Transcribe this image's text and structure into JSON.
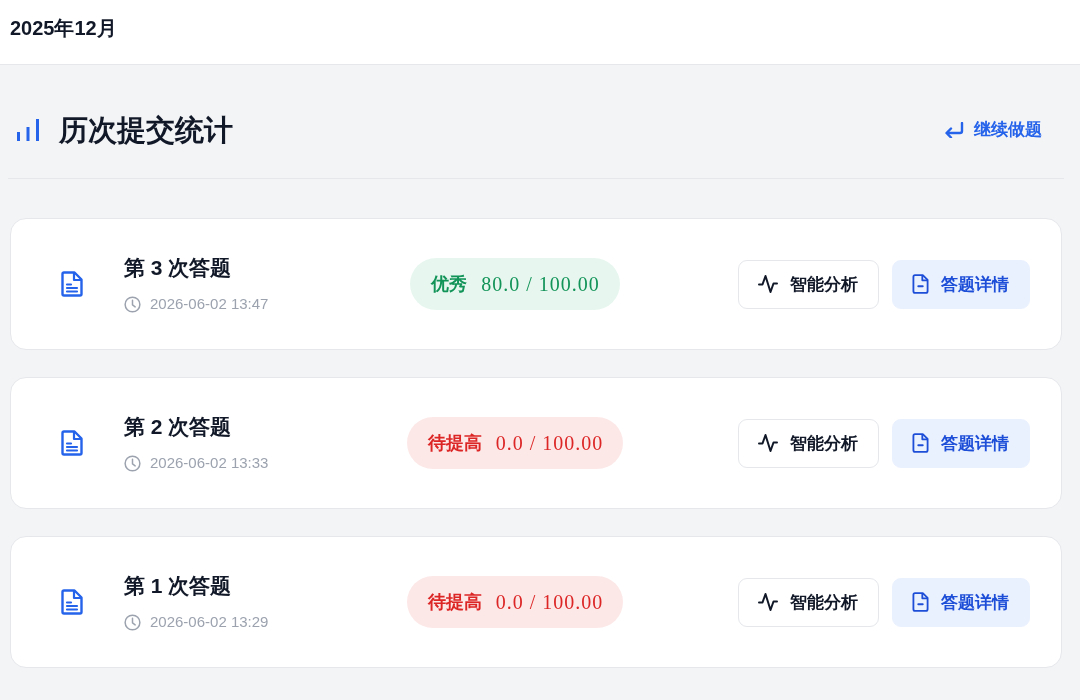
{
  "top_bar": {
    "title": "2025年12月"
  },
  "header": {
    "title": "历次提交统计",
    "continue_link": "继续做题"
  },
  "submissions": [
    {
      "title": "第 3 次答题",
      "time": "2026-06-02 13:47",
      "grade": {
        "kind": "excellent",
        "label": "优秀",
        "score": "80.0 / 100.00"
      },
      "buttons": [
        {
          "kind": "analysis",
          "label": "智能分析"
        },
        {
          "kind": "details",
          "label": "答题详情"
        }
      ]
    },
    {
      "title": "第 2 次答题",
      "time": "2026-06-02 13:33",
      "grade": {
        "kind": "needs_improvement",
        "label": "待提高",
        "score": "0.0 / 100.00"
      },
      "buttons": [
        {
          "kind": "analysis",
          "label": "智能分析"
        },
        {
          "kind": "details",
          "label": "答题详情"
        }
      ]
    },
    {
      "title": "第 1 次答题",
      "time": "2026-06-02 13:29",
      "grade": {
        "kind": "needs_improvement",
        "label": "待提高",
        "score": "0.0 / 100.00"
      },
      "buttons": [
        {
          "kind": "analysis",
          "label": "智能分析"
        },
        {
          "kind": "details",
          "label": "答题详情"
        }
      ]
    }
  ]
}
